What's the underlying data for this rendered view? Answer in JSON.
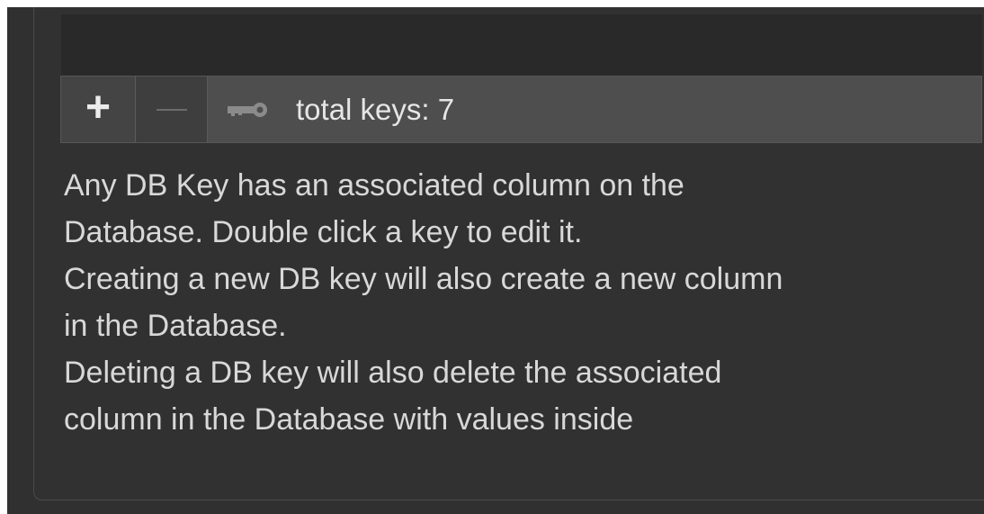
{
  "toolbar": {
    "add_label": "+",
    "status_text": "total keys: 7",
    "key_icon": "key-icon",
    "add_icon": "plus-icon",
    "remove_icon": "minus-icon"
  },
  "help": {
    "lines": [
      "Any DB Key has an associated column on the",
      "Database. Double click a key to edit it.",
      "Creating a new DB key will also create a new column",
      "in the Database.",
      "Deleting a DB key will also delete the associated",
      "column in the Database with values inside"
    ]
  },
  "colors": {
    "background": "#2f302f",
    "text": "#d8d8d8",
    "toolbar": "#4d4e4d"
  }
}
